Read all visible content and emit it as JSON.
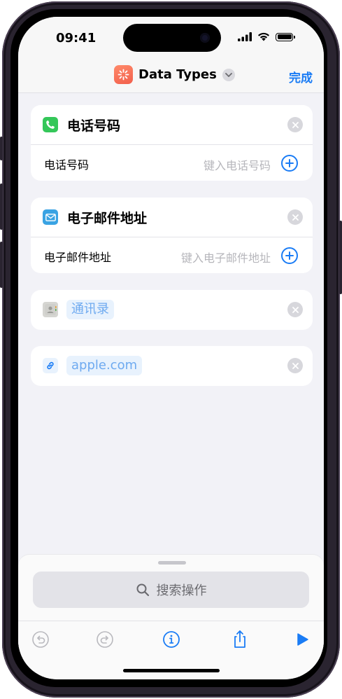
{
  "status_bar": {
    "time": "09:41"
  },
  "nav": {
    "title": "Data Types",
    "done_label": "完成"
  },
  "cards": {
    "phone": {
      "title": "电话号码",
      "field_label": "电话号码",
      "placeholder": "键入电话号码",
      "icon": "phone-icon",
      "icon_color": "#34c759"
    },
    "email": {
      "title": "电子邮件地址",
      "field_label": "电子邮件地址",
      "placeholder": "键入电子邮件地址",
      "icon": "mail-icon",
      "icon_color": "#3aa3e3"
    },
    "contacts": {
      "token": "通讯录",
      "icon": "contacts-icon"
    },
    "url": {
      "token": "apple.com",
      "icon": "link-icon"
    }
  },
  "bottom": {
    "search_placeholder": "搜索操作"
  },
  "colors": {
    "accent": "#1a7cf5",
    "background": "#f2f2f7",
    "token_bg": "#e8f2fd",
    "token_text": "#6eaaf0"
  }
}
